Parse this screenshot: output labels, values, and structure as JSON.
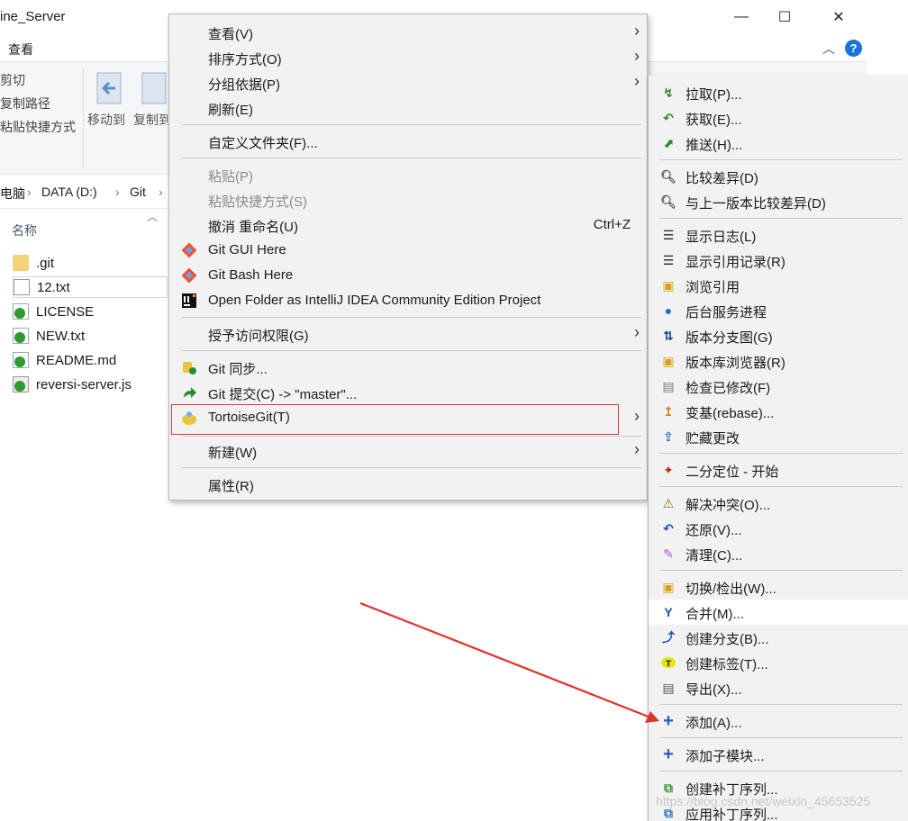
{
  "window": {
    "title": "ine_Server",
    "minimize": "—",
    "maximize": "☐",
    "close": "✕",
    "help": "?",
    "ribbon_collapse": "︿"
  },
  "ribbon": {
    "tab_view": "查看",
    "cut": "剪切",
    "copy_path": "复制路径",
    "paste_shortcut": "粘贴快捷方式",
    "move_to": "移动到",
    "copy_to": "复制到"
  },
  "address": {
    "crumbs": [
      "电脑",
      "DATA (D:)",
      "Git"
    ]
  },
  "file_list": {
    "header_name": "名称",
    "files": [
      ".git",
      "12.txt",
      "LICENSE",
      "NEW.txt",
      "README.md",
      "reversi-server.js"
    ]
  },
  "menu1": {
    "view": "查看(V)",
    "sort_by": "排序方式(O)",
    "group_by": "分组依据(P)",
    "refresh": "刷新(E)",
    "customize_folder": "自定义文件夹(F)...",
    "paste": "粘贴(P)",
    "paste_shortcut": "粘贴快捷方式(S)",
    "undo_rename": "撤消 重命名(U)",
    "undo_shortcut": "Ctrl+Z",
    "git_gui": "Git GUI Here",
    "git_bash": "Git Bash Here",
    "intellij": "Open Folder as IntelliJ IDEA Community Edition Project",
    "grant_access": "授予访问权限(G)",
    "git_sync": "Git 同步...",
    "git_commit": "Git 提交(C) -> \"master\"...",
    "tortoisegit": "TortoiseGit(T)",
    "new": "新建(W)",
    "properties": "属性(R)"
  },
  "menu2": {
    "items": [
      {
        "label": "拉取(P)...",
        "icon": "pull-icon",
        "color": "#2b8a2b"
      },
      {
        "label": "获取(E)...",
        "icon": "fetch-icon",
        "color": "#2b8a2b"
      },
      {
        "label": "推送(H)...",
        "icon": "push-icon",
        "color": "#2b8a2b"
      },
      {
        "label": "比较差异(D)",
        "icon": "diff-icon",
        "color": "#555555"
      },
      {
        "label": "与上一版本比较差异(D)",
        "icon": "diff-prev-icon",
        "color": "#555555"
      },
      {
        "label": "显示日志(L)",
        "icon": "log-icon",
        "color": "#222222"
      },
      {
        "label": "显示引用记录(R)",
        "icon": "reflog-icon",
        "color": "#222222"
      },
      {
        "label": "浏览引用",
        "icon": "browse-refs-icon",
        "color": "#d4a017"
      },
      {
        "label": "后台服务进程",
        "icon": "daemon-icon",
        "color": "#1e6fbf"
      },
      {
        "label": "版本分支图(G)",
        "icon": "revision-graph-icon",
        "color": "#1e3f8f"
      },
      {
        "label": "版本库浏览器(R)",
        "icon": "repo-browser-icon",
        "color": "#d4a017"
      },
      {
        "label": "检查已修改(F)",
        "icon": "check-modified-icon",
        "color": "#777777"
      },
      {
        "label": "变基(rebase)...",
        "icon": "rebase-icon",
        "color": "#d47a17"
      },
      {
        "label": "贮藏更改",
        "icon": "stash-icon",
        "color": "#1e6fbf"
      },
      {
        "label": "二分定位 - 开始",
        "icon": "bisect-icon",
        "color": "#c22a2a"
      },
      {
        "label": "解决冲突(O)...",
        "icon": "resolve-icon",
        "color": "#8a7a10"
      },
      {
        "label": "还原(V)...",
        "icon": "revert-icon",
        "color": "#1e4fbf"
      },
      {
        "label": "清理(C)...",
        "icon": "cleanup-icon",
        "color": "#b05ad0"
      },
      {
        "label": "切换/检出(W)...",
        "icon": "switch-icon",
        "color": "#d4a017"
      },
      {
        "label": "合并(M)...",
        "icon": "merge-icon",
        "color": "#1e4fbf"
      },
      {
        "label": "创建分支(B)...",
        "icon": "branch-icon",
        "color": "#1e4fbf"
      },
      {
        "label": "创建标签(T)...",
        "icon": "tag-icon",
        "color": "#e6d400"
      },
      {
        "label": "导出(X)...",
        "icon": "export-icon",
        "color": "#555555"
      },
      {
        "label": "添加(A)...",
        "icon": "add-icon",
        "color": "#1e5fbf"
      },
      {
        "label": "添加子模块...",
        "icon": "add-submodule-icon",
        "color": "#1e5fbf"
      },
      {
        "label": "创建补丁序列...",
        "icon": "create-patch-icon",
        "color": "#3a9a3a"
      },
      {
        "label": "应用补丁序列...",
        "icon": "apply-patch-icon",
        "color": "#3a7abf"
      }
    ]
  },
  "watermark": "https://blog.csdn.net/weixin_45653525",
  "colors": {
    "highlight_box": "#d63a3a",
    "annotation_arrow": "#e0302c"
  }
}
